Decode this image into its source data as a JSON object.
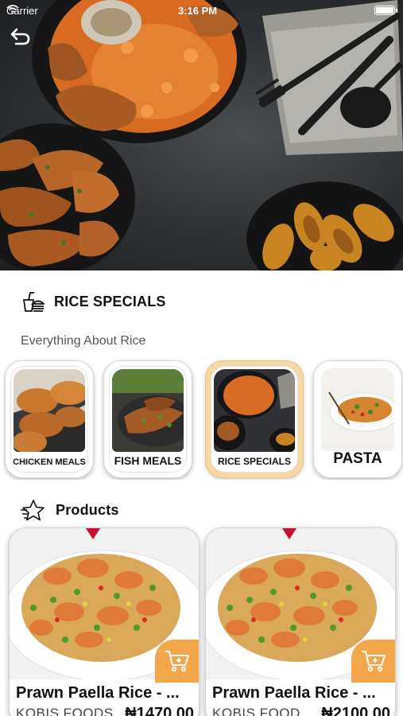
{
  "status_bar": {
    "carrier": "Carrier",
    "time": "3:16 PM"
  },
  "category_section": {
    "title": "RICE SPECIALS",
    "subtitle": "Everything About Rice",
    "categories": [
      {
        "label": "CHICKEN MEALS",
        "selected": false
      },
      {
        "label": "FISH MEALS",
        "selected": false
      },
      {
        "label": "RICE SPECIALS",
        "selected": true
      },
      {
        "label": "PASTA",
        "selected": false
      }
    ]
  },
  "products_section": {
    "title": "Products",
    "items": [
      {
        "name": "Prawn Paella Rice - ...",
        "vendor": "KOBIS FOODS",
        "price": "₦1470.00"
      },
      {
        "name": "Prawn Paella Rice - ...",
        "vendor": "KOBIS FOOD",
        "price": "₦2100.00"
      }
    ]
  },
  "colors": {
    "accent": "#f4a64a",
    "selected_card": "#f6d8a4",
    "ribbon": "#c8102e"
  },
  "icons": [
    "wifi-icon",
    "battery-icon",
    "back-arrow-icon",
    "fast-food-icon",
    "star-icon",
    "cart-icon"
  ]
}
